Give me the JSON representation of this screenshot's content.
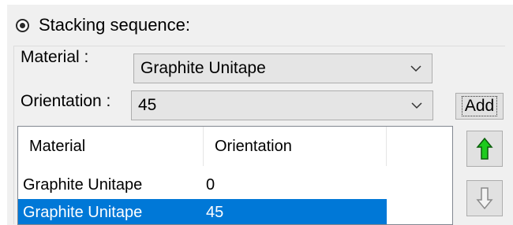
{
  "stacking": {
    "radio_label": "Stacking sequence:",
    "radio_selected": true,
    "material_label": "Material :",
    "material_value": "Graphite Unitape",
    "orientation_label": "Orientation :",
    "orientation_value": "45",
    "add_label": "Add",
    "table": {
      "headers": [
        "Material",
        "Orientation"
      ],
      "rows": [
        {
          "material": "Graphite Unitape",
          "orientation": "0",
          "selected": false
        },
        {
          "material": "Graphite Unitape",
          "orientation": "45",
          "selected": true
        }
      ]
    },
    "move_up_icon": "green-up-arrow-icon",
    "move_down_icon": "gray-down-arrow-icon"
  },
  "colors": {
    "selection": "#0078d7",
    "up_arrow": "#1ecb1e",
    "panel": "#f0f0f0"
  }
}
